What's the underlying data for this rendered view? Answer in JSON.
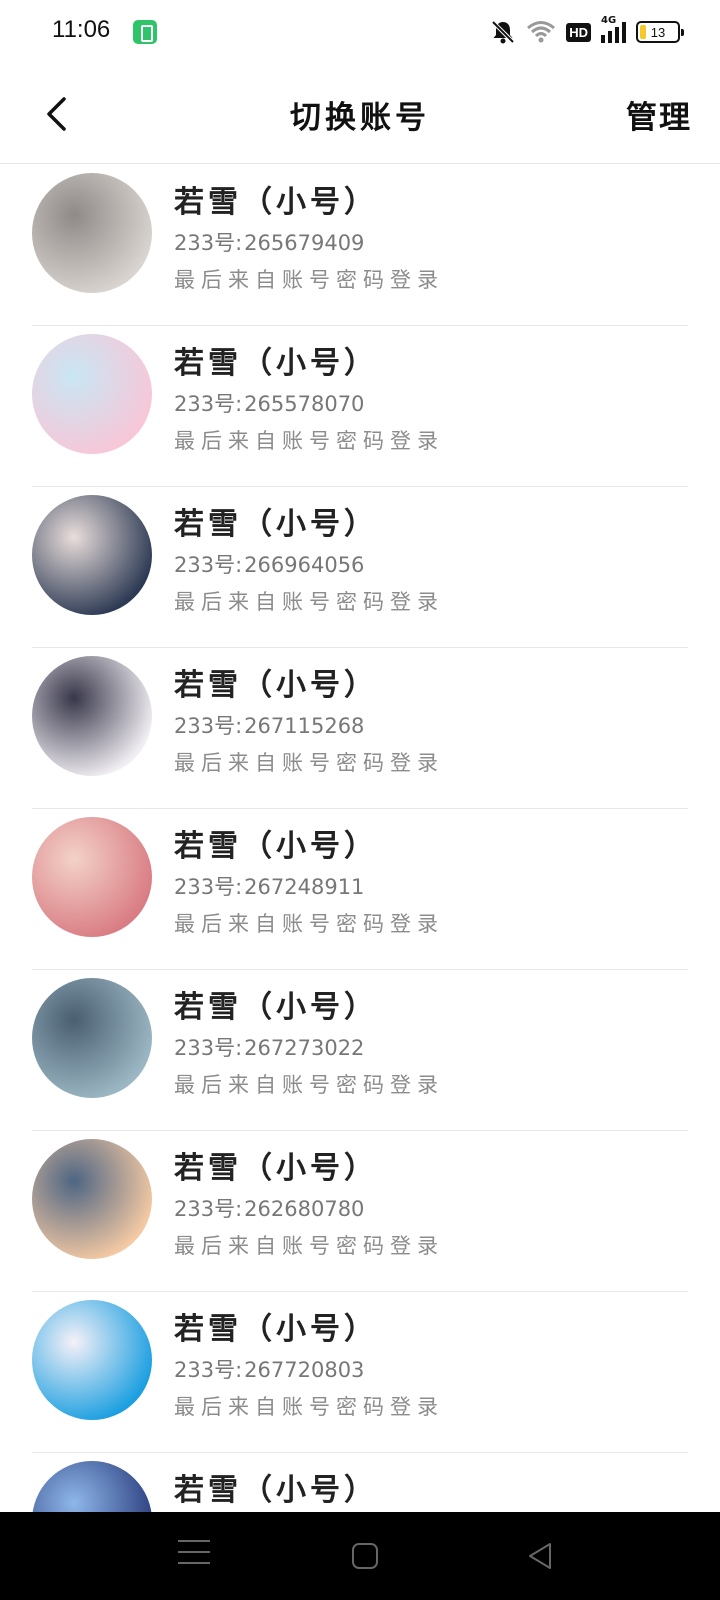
{
  "status_bar": {
    "time": "11:06",
    "hd_label": "HD",
    "network_label": "4G",
    "battery_level": "13"
  },
  "header": {
    "back_icon": "chevron-left-icon",
    "title": "切换账号",
    "manage_label": "管理"
  },
  "accounts": [
    {
      "name": "若雪（小号）",
      "uid_prefix": "233号:",
      "uid": "265679409",
      "last_login": "最后来自账号密码登录",
      "avatar_colors": [
        "#d9d4cf",
        "#8f8a88"
      ]
    },
    {
      "name": "若雪（小号）",
      "uid_prefix": "233号:",
      "uid": "265578070",
      "last_login": "最后来自账号密码登录",
      "avatar_colors": [
        "#f7c7d8",
        "#c9e6f3"
      ]
    },
    {
      "name": "若雪（小号）",
      "uid_prefix": "233号:",
      "uid": "266964056",
      "last_login": "最后来自账号密码登录",
      "avatar_colors": [
        "#2d3a54",
        "#e9dedb"
      ]
    },
    {
      "name": "若雪（小号）",
      "uid_prefix": "233号:",
      "uid": "267115268",
      "last_login": "最后来自账号密码登录",
      "avatar_colors": [
        "#f1eef3",
        "#38374a"
      ]
    },
    {
      "name": "若雪（小号）",
      "uid_prefix": "233号:",
      "uid": "267248911",
      "last_login": "最后来自账号密码登录",
      "avatar_colors": [
        "#d97c83",
        "#f3d2c8"
      ]
    },
    {
      "name": "若雪（小号）",
      "uid_prefix": "233号:",
      "uid": "267273022",
      "last_login": "最后来自账号密码登录",
      "avatar_colors": [
        "#9cb7c4",
        "#4a5f70"
      ]
    },
    {
      "name": "若雪（小号）",
      "uid_prefix": "233号:",
      "uid": "262680780",
      "last_login": "最后来自账号密码登录",
      "avatar_colors": [
        "#f4c9a3",
        "#4e6583"
      ]
    },
    {
      "name": "若雪（小号）",
      "uid_prefix": "233号:",
      "uid": "267720803",
      "last_login": "最后来自账号密码登录",
      "avatar_colors": [
        "#1b9fe0",
        "#f5f1f8"
      ]
    },
    {
      "name": "若雪（小号）",
      "uid_prefix": "",
      "uid": "",
      "last_login": "",
      "avatar_colors": [
        "#2b3e7e",
        "#8fb7ea"
      ]
    }
  ],
  "nav_bar": {
    "menu_icon": "menu-icon",
    "home_icon": "home-square-icon",
    "back_icon": "back-triangle-icon"
  }
}
